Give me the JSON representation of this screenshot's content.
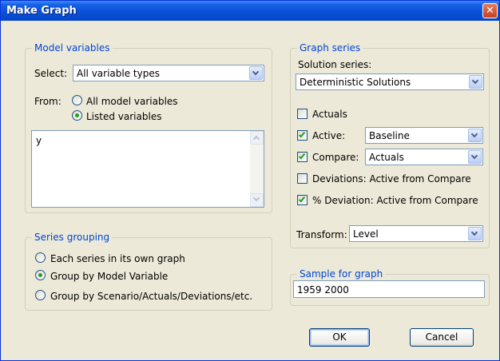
{
  "window": {
    "title": "Make Graph",
    "close_symbol": "✕"
  },
  "model_variables": {
    "legend": "Model variables",
    "select_label": "Select:",
    "select_value": "All variable types",
    "from_label": "From:",
    "radio_all": "All model variables",
    "radio_listed": "Listed variables",
    "from_selected": "Listed variables",
    "listed_text": "y"
  },
  "series_grouping": {
    "legend": "Series grouping",
    "options": [
      "Each series in its own graph",
      "Group by Model Variable",
      "Group by Scenario/Actuals/Deviations/etc."
    ],
    "selected": "Group by Model Variable"
  },
  "graph_series": {
    "legend": "Graph series",
    "solution_series_label": "Solution series:",
    "solution_series_value": "Deterministic Solutions",
    "actuals_label": "Actuals",
    "actuals_checked": false,
    "active_label": "Active:",
    "active_checked": true,
    "active_value": "Baseline",
    "compare_label": "Compare:",
    "compare_checked": true,
    "compare_value": "Actuals",
    "deviations_label": "Deviations: Active from Compare",
    "deviations_checked": false,
    "pct_deviation_label": "% Deviation: Active from Compare",
    "pct_deviation_checked": true,
    "transform_label": "Transform:",
    "transform_value": "Level"
  },
  "sample": {
    "legend": "Sample for graph",
    "value": "1959 2000"
  },
  "buttons": {
    "ok": "OK",
    "cancel": "Cancel"
  }
}
